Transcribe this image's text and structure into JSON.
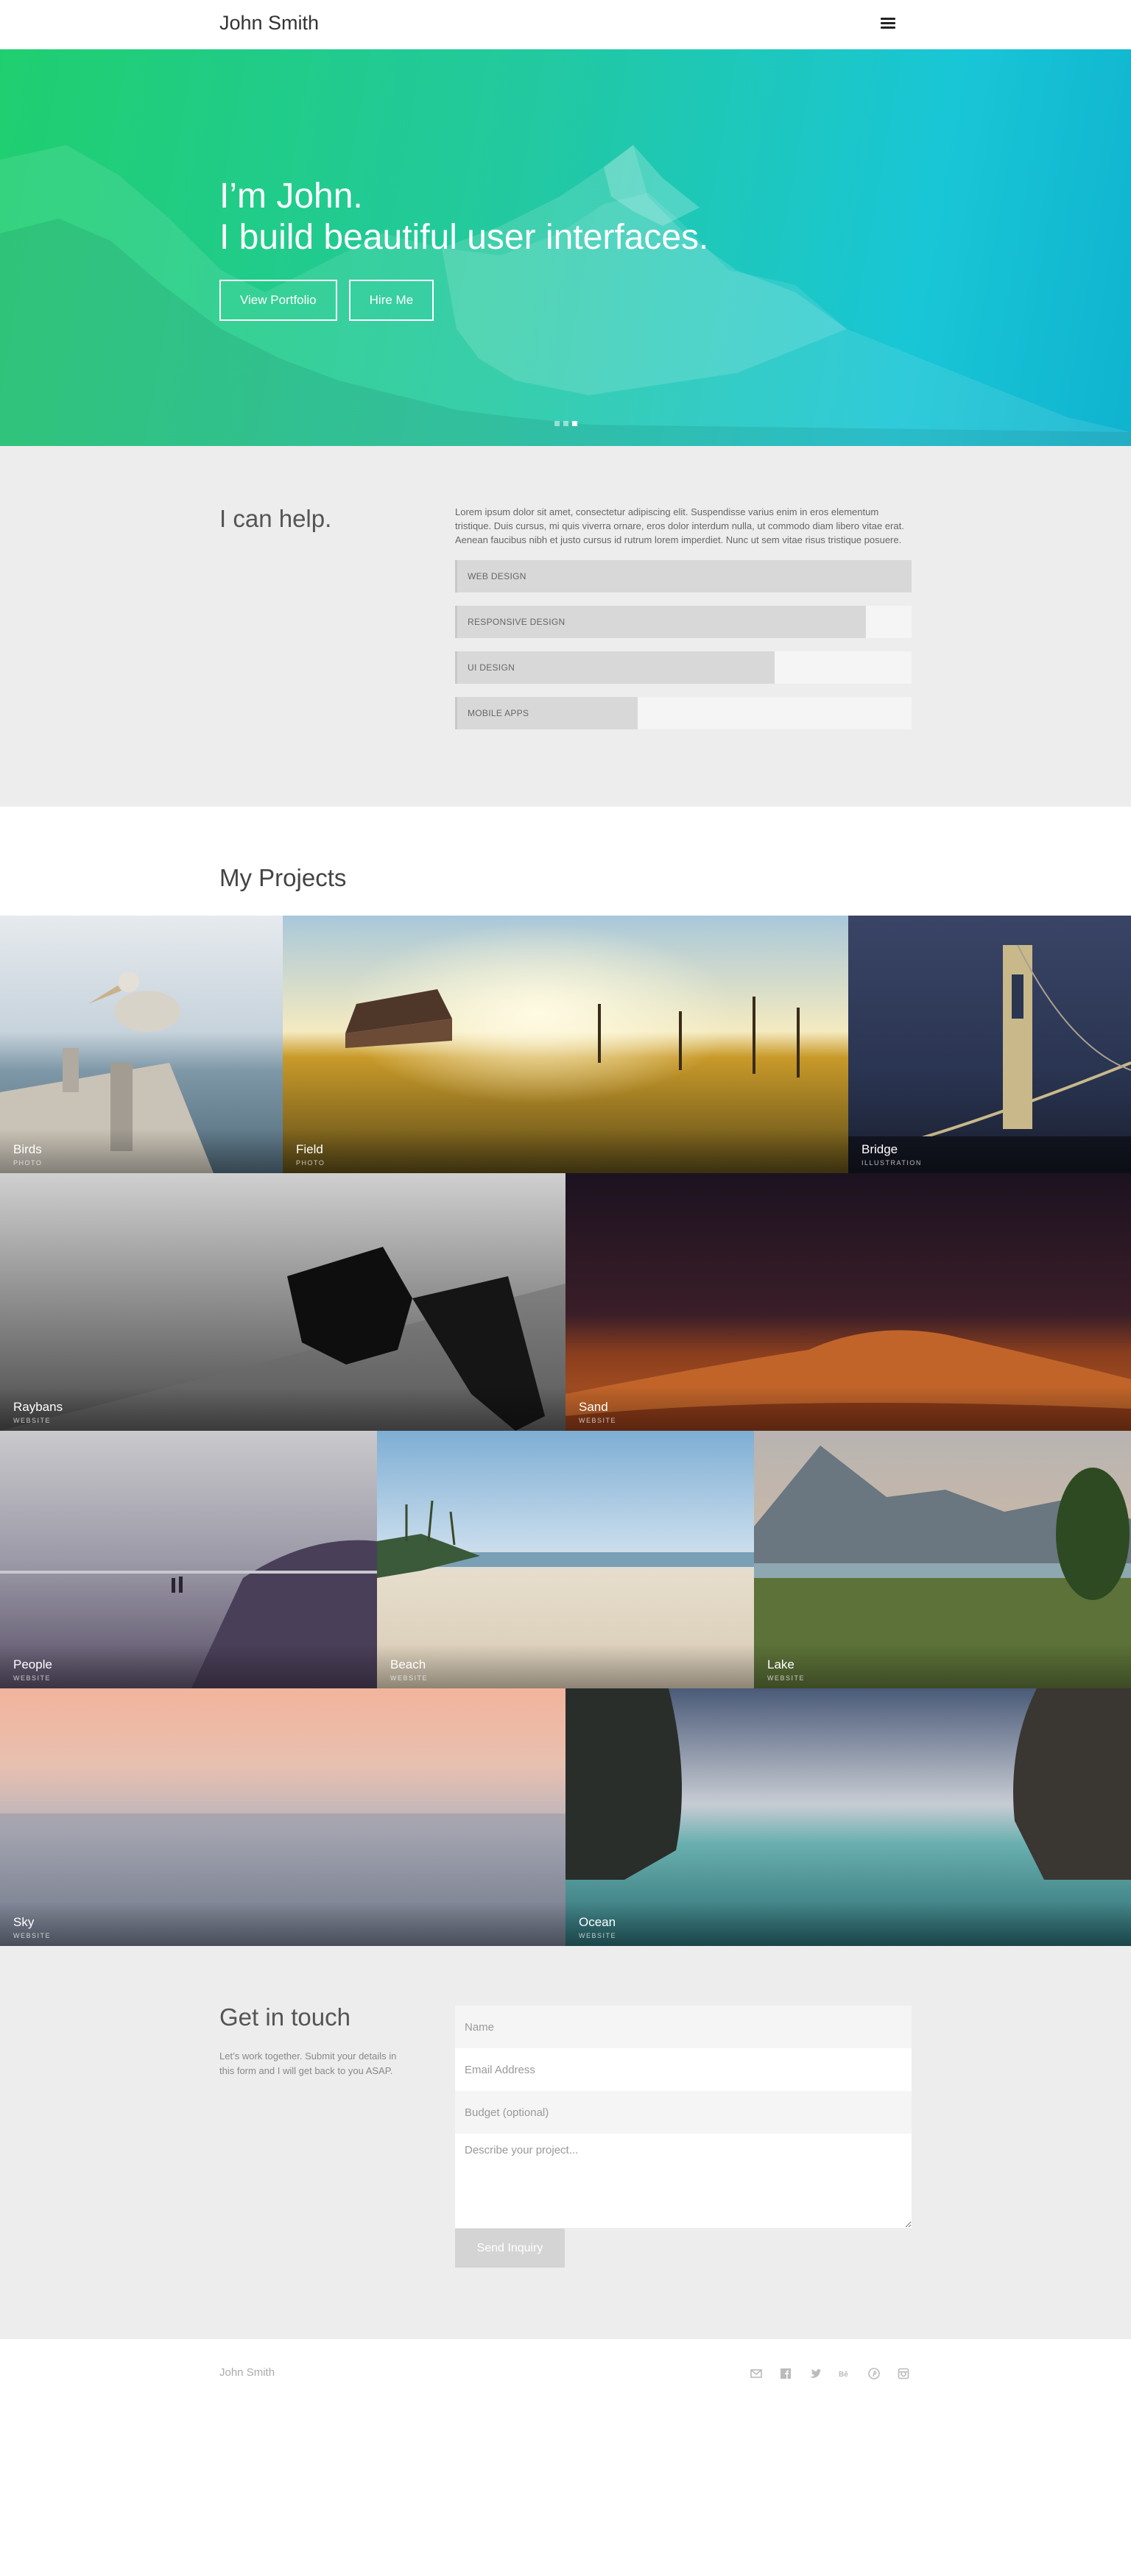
{
  "header": {
    "brand": "John Smith",
    "menu_icon": "hamburger-menu-icon"
  },
  "hero": {
    "line1": "I’m John.",
    "line2": "I build beautiful user interfaces.",
    "portfolio_label": "View Portfolio",
    "hire_label": "Hire Me",
    "slides": 3,
    "active_slide": 3,
    "gradient": [
      "#1fcf6f",
      "#19c6d6"
    ]
  },
  "help": {
    "title": "I can help.",
    "text": "Lorem ipsum dolor sit amet, consectetur adipiscing elit. Suspendisse varius enim in eros elementum tristique. Duis cursus, mi quis viverra ornare, eros dolor interdum nulla, ut commodo diam libero vitae erat. Aenean faucibus nibh et justo cursus id rutrum lorem imperdiet. Nunc ut sem vitae risus tristique posuere.",
    "skills": [
      {
        "label": "WEB DESIGN",
        "level": 1.0
      },
      {
        "label": "RESPONSIVE DESIGN",
        "level": 0.9
      },
      {
        "label": "UI DESIGN",
        "level": 0.7
      },
      {
        "label": "MOBILE APPS",
        "level": 0.4
      }
    ]
  },
  "projects": {
    "title": "My Projects",
    "items": [
      {
        "name": "Birds",
        "category": "PHOTO"
      },
      {
        "name": "Field",
        "category": "PHOTO"
      },
      {
        "name": "Bridge",
        "category": "ILLUSTRATION"
      },
      {
        "name": "Raybans",
        "category": "WEBSITE"
      },
      {
        "name": "Sand",
        "category": "WEBSITE"
      },
      {
        "name": "People",
        "category": "WEBSITE"
      },
      {
        "name": "Beach",
        "category": "WEBSITE"
      },
      {
        "name": "Lake",
        "category": "WEBSITE"
      },
      {
        "name": "Sky",
        "category": "WEBSITE"
      },
      {
        "name": "Ocean",
        "category": "WEBSITE"
      }
    ]
  },
  "contact": {
    "title": "Get in touch",
    "desc": "Let’s work together. Submit your details in this form and I will get back to you ASAP.",
    "name_placeholder": "Name",
    "email_placeholder": "Email Address",
    "budget_placeholder": "Budget (optional)",
    "project_placeholder": "Describe your project...",
    "send_label": "Send Inquiry"
  },
  "footer": {
    "brand": "John Smith",
    "socials": [
      "email-icon",
      "facebook-icon",
      "twitter-icon",
      "behance-icon",
      "pinterest-icon",
      "instagram-icon"
    ]
  }
}
